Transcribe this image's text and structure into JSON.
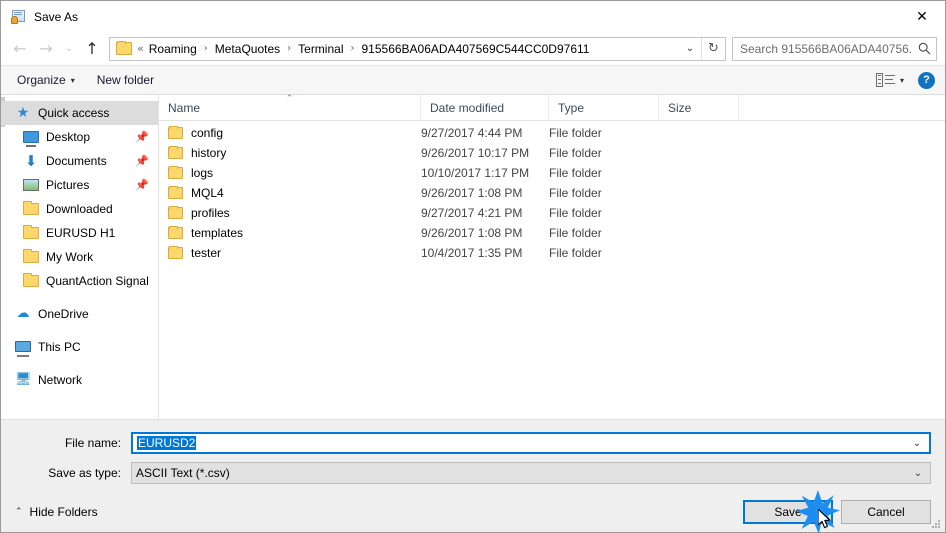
{
  "window": {
    "title": "Save As",
    "icon": "save-as-icon",
    "close_label": "✕"
  },
  "nav": {
    "back_label": "←",
    "forward_label": "→",
    "recent_label": "⌄",
    "up_label": "↑",
    "breadcrumb_prefix": "«",
    "breadcrumb": [
      "Roaming",
      "MetaQuotes",
      "Terminal",
      "915566BA06ADA407569C544CC0D97611"
    ],
    "separator": "›",
    "address_chevron": "⌄",
    "refresh_label": "↻"
  },
  "search": {
    "placeholder": "Search 915566BA06ADA40756...",
    "icon": "search-icon"
  },
  "toolbar": {
    "organize_label": "Organize",
    "organize_caret": "▾",
    "new_folder_label": "New folder",
    "view_caret": "▾",
    "help_label": "?"
  },
  "sidebar": {
    "items": [
      {
        "label": "Quick access",
        "icon": "star-icon",
        "selected": true,
        "pinned": false,
        "root": true
      },
      {
        "label": "Desktop",
        "icon": "desktop-icon",
        "selected": false,
        "pinned": true,
        "root": false
      },
      {
        "label": "Documents",
        "icon": "documents-icon",
        "selected": false,
        "pinned": true,
        "root": false
      },
      {
        "label": "Pictures",
        "icon": "pictures-icon",
        "selected": false,
        "pinned": true,
        "root": false
      },
      {
        "label": "Downloaded",
        "icon": "folder-icon",
        "selected": false,
        "pinned": false,
        "root": false
      },
      {
        "label": "EURUSD H1",
        "icon": "folder-icon",
        "selected": false,
        "pinned": false,
        "root": false
      },
      {
        "label": "My Work",
        "icon": "folder-icon",
        "selected": false,
        "pinned": false,
        "root": false
      },
      {
        "label": "QuantAction Signal",
        "icon": "folder-icon",
        "selected": false,
        "pinned": false,
        "root": false
      },
      {
        "label": "OneDrive",
        "icon": "onedrive-icon",
        "selected": false,
        "pinned": false,
        "root": true
      },
      {
        "label": "This PC",
        "icon": "this-pc-icon",
        "selected": false,
        "pinned": false,
        "root": true
      },
      {
        "label": "Network",
        "icon": "network-icon",
        "selected": false,
        "pinned": false,
        "root": true
      }
    ],
    "pin_glyph": "📌"
  },
  "filelist": {
    "columns": [
      "Name",
      "Date modified",
      "Type",
      "Size"
    ],
    "sort_caret": "⌃",
    "rows": [
      {
        "name": "config",
        "date": "9/27/2017 4:44 PM",
        "type": "File folder",
        "size": ""
      },
      {
        "name": "history",
        "date": "9/26/2017 10:17 PM",
        "type": "File folder",
        "size": ""
      },
      {
        "name": "logs",
        "date": "10/10/2017 1:17 PM",
        "type": "File folder",
        "size": ""
      },
      {
        "name": "MQL4",
        "date": "9/26/2017 1:08 PM",
        "type": "File folder",
        "size": ""
      },
      {
        "name": "profiles",
        "date": "9/27/2017 4:21 PM",
        "type": "File folder",
        "size": ""
      },
      {
        "name": "templates",
        "date": "9/26/2017 1:08 PM",
        "type": "File folder",
        "size": ""
      },
      {
        "name": "tester",
        "date": "10/4/2017 1:35 PM",
        "type": "File folder",
        "size": ""
      }
    ]
  },
  "form": {
    "filename_label": "File name:",
    "filename_value": "EURUSD2",
    "filetype_label": "Save as type:",
    "filetype_value": "ASCII Text (*.csv)",
    "dropdown_glyph": "⌄"
  },
  "footer": {
    "hide_folders_label": "Hide Folders",
    "hide_folders_caret": "⌃",
    "save_label": "Save",
    "cancel_label": "Cancel"
  },
  "colors": {
    "accent": "#0078d7",
    "selection": "#0078d7",
    "folder": "#fcd86c",
    "burst": "#1d8ef0"
  }
}
